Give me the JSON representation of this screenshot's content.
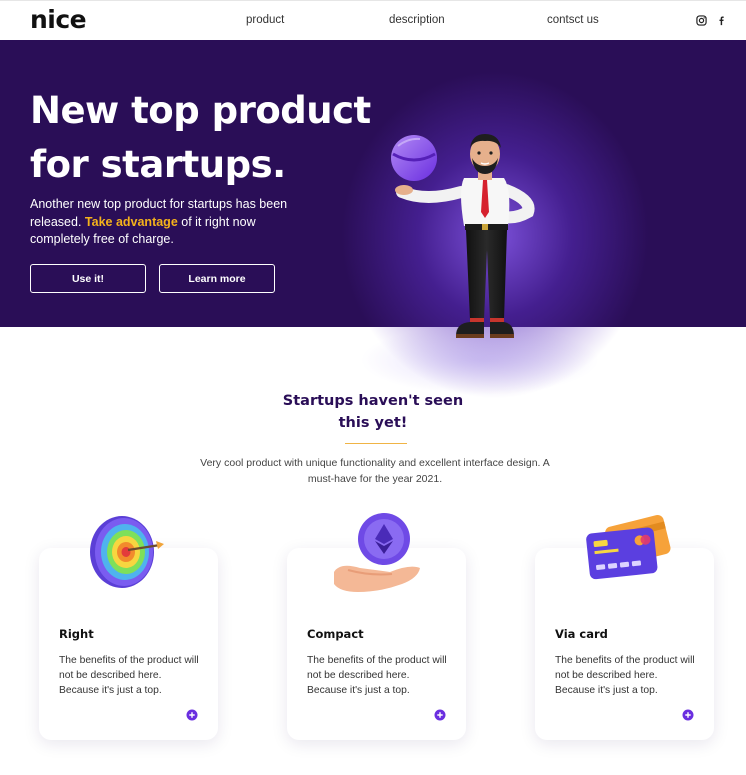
{
  "brand": {
    "logo": "nice"
  },
  "nav": {
    "links": [
      "product",
      "description",
      "contsct us"
    ],
    "social": [
      "instagram-icon",
      "facebook-icon"
    ]
  },
  "hero": {
    "title_line1": "New top product",
    "title_line2": "for startups.",
    "desc_before": "Another new top product for startups has been released. ",
    "desc_highlight": "Take advantage",
    "desc_after": " of it right now completely free of charge.",
    "btn_primary": "Use it!",
    "btn_secondary": "Learn more"
  },
  "section": {
    "title_line1": "Startups haven't seen",
    "title_line2": "this yet!",
    "desc": "Very cool product with unique functionality and excellent interface design. A must-have for the year 2021."
  },
  "cards": [
    {
      "title": "Right",
      "text": "The benefits of the product will not be described here. Because it's just a top.",
      "icon": "target-icon"
    },
    {
      "title": "Compact",
      "text": "The benefits of the product will not be described here. Because it's just a top.",
      "icon": "hand-coin-icon"
    },
    {
      "title": "Via card",
      "text": "The benefits of the product will not be described here. Because it's just a top.",
      "icon": "credit-card-icon"
    }
  ],
  "colors": {
    "hero_bg": "#2a0e57",
    "accent_yellow": "#f5b21b",
    "accent_purple": "#6a2ee0",
    "title_purple": "#2a0e57"
  }
}
